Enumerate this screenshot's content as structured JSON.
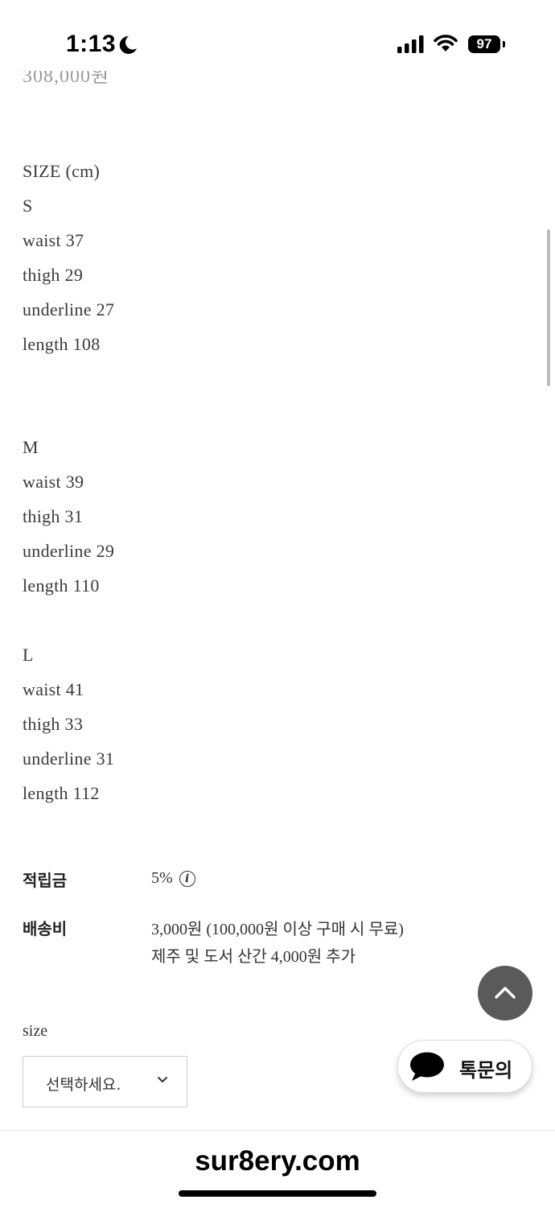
{
  "status_bar": {
    "time": "1:13",
    "battery": "97"
  },
  "product": {
    "price_partial": "308,000원",
    "spec_lines": [
      "SIZE (cm)",
      "S",
      "waist 37",
      "thigh 29",
      "underline 27",
      "length 108",
      "M",
      "waist 39",
      "thigh 31",
      "underline 29",
      "length 110",
      "L",
      "waist 41",
      "thigh 33",
      "underline 31",
      "length 112"
    ]
  },
  "info": {
    "points_label": "적립금",
    "points_value": "5%",
    "shipping_label": "배송비",
    "shipping_value_1": "3,000원 (100,000원 이상 구매 시 무료)",
    "shipping_value_2": "제주 및 도서 산간 4,000원 추가"
  },
  "option": {
    "label": "size",
    "placeholder": "선택하세요."
  },
  "chat": {
    "label": "톡문의"
  },
  "browser": {
    "domain": "sur8ery.com"
  },
  "icons": [
    "moon-icon",
    "signal-icon",
    "wifi-icon",
    "info-icon",
    "chevron-down-icon",
    "chevron-up-icon",
    "chat-bubble-icon"
  ]
}
